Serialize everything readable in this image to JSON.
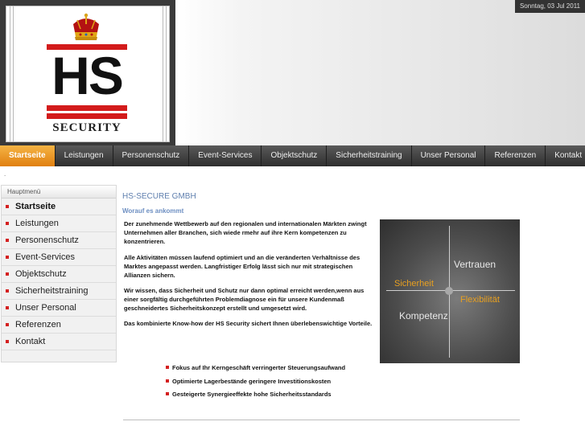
{
  "header": {
    "logo_text": "HS",
    "logo_subtext": "SECURITY",
    "date": "Sonntag, 03 Jul 2011"
  },
  "nav": {
    "items": [
      {
        "label": "Startseite",
        "active": true
      },
      {
        "label": "Leistungen"
      },
      {
        "label": "Personenschutz"
      },
      {
        "label": "Event-Services"
      },
      {
        "label": "Objektschutz"
      },
      {
        "label": "Sicherheitstraining"
      },
      {
        "label": "Unser Personal"
      },
      {
        "label": "Referenzen"
      },
      {
        "label": "Kontakt"
      }
    ]
  },
  "breadcrumb_marker": ".",
  "sidebar": {
    "title": "Hauptmenü",
    "items": [
      {
        "label": "Startseite",
        "active": true
      },
      {
        "label": "Leistungen"
      },
      {
        "label": "Personenschutz"
      },
      {
        "label": "Event-Services"
      },
      {
        "label": "Objektschutz"
      },
      {
        "label": "Sicherheitstraining"
      },
      {
        "label": "Unser Personal"
      },
      {
        "label": "Referenzen"
      },
      {
        "label": "Kontakt"
      }
    ]
  },
  "main": {
    "title": "HS-SECURE GMBH",
    "subtitle": "Worauf es ankommt",
    "paragraphs": [
      "Der zunehmende Wettbewerb auf den regionalen und internationalen Märkten zwingt          Unternehmen aller Branchen, sich wiede rmehr auf ihre Kern kompetenzen zu konzentrieren.",
      "Alle Aktivitäten müssen laufend optimiert und an die veränderten Verhältnisse des Marktes angepasst werden. Langfristiger Erfolg lässt sich nur mit strategischen Allianzen sichern.",
      "Wir wissen, dass Sicherheit und Schutz nur dann optimal erreicht werden,wenn aus einer sorgfältig durchgeführten Problemdiagnose ein für unsere Kundenmaß geschneidertes Sicherheitskonzept erstellt und umgesetzt wird.",
      "Das kombinierte Know-how der HS Security sichert Ihnen überlebenswichtige Vorteile."
    ],
    "graphic": {
      "labels": [
        "Vertrauen",
        "Sicherheit",
        "Flexibilität",
        "Kompetenz"
      ],
      "colors": {
        "light": "#e8e8e8",
        "accent": "#e8a020"
      }
    },
    "bullets": [
      "Fokus auf Ihr Kerngeschäft verringerter Steuerungsaufwand",
      "Optimierte Lagerbestände geringere Investitionskosten",
      "Gesteigerte Synergieeffekte hohe Sicherheitsstandards"
    ]
  },
  "colors": {
    "accent_orange": "#e89a2a",
    "bullet_red": "#d42020",
    "title_blue": "#5f7fae"
  }
}
